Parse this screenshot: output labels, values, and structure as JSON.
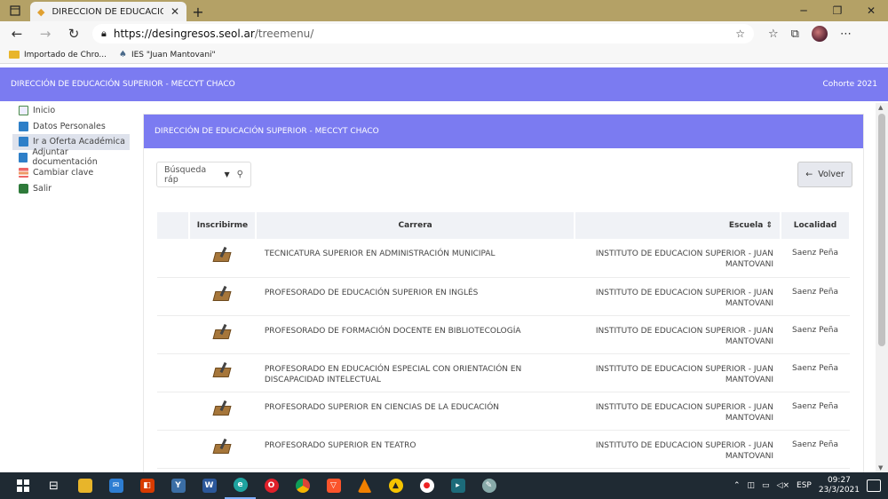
{
  "browser": {
    "tab_title": "DIRECCIÓN DE EDUCACIÓN SUP",
    "url_host": "https://desingresos.seol.ar",
    "url_path": "/treemenu/",
    "bookmarks": [
      {
        "label": "Importado de Chro..."
      },
      {
        "label": "IES \"Juan Mantovani\""
      }
    ]
  },
  "header": {
    "title": "DIRECCIÓN DE EDUCACIÓN SUPERIOR - MECCYT CHACO",
    "cohorte": "Cohorte 2021"
  },
  "sidebar": {
    "items": [
      {
        "label": "Inicio",
        "icon": "home-icon"
      },
      {
        "label": "Datos Personales",
        "icon": "card-icon"
      },
      {
        "label": "Ir a Oferta Académica",
        "icon": "card-icon"
      },
      {
        "label": "Adjuntar documentación",
        "icon": "card-icon"
      },
      {
        "label": "Cambiar clave",
        "icon": "key-icon"
      },
      {
        "label": "Salir",
        "icon": "exit-icon"
      }
    ]
  },
  "content": {
    "title": "DIRECCIÓN DE EDUCACIÓN SUPERIOR - MECCYT CHACO",
    "search_placeholder": "Búsqueda ráp",
    "volver_label": "Volver"
  },
  "table": {
    "headers": [
      "",
      "Inscribirme",
      "Carrera",
      "Escuela ⇕",
      "Localidad"
    ],
    "rows": [
      {
        "carrera": "TECNICATURA SUPERIOR EN ADMINISTRACIÓN MUNICIPAL",
        "escuela": "INSTITUTO DE EDUCACION SUPERIOR - JUAN MANTOVANI",
        "localidad": "Saenz Peña"
      },
      {
        "carrera": "PROFESORADO DE EDUCACIÓN SUPERIOR EN INGLÉS",
        "escuela": "INSTITUTO DE EDUCACION SUPERIOR - JUAN MANTOVANI",
        "localidad": "Saenz Peña"
      },
      {
        "carrera": "PROFESORADO DE FORMACIÓN DOCENTE EN BIBLIOTECOLOGÍA",
        "escuela": "INSTITUTO DE EDUCACION SUPERIOR - JUAN MANTOVANI",
        "localidad": "Saenz Peña"
      },
      {
        "carrera": "PROFESORADO EN EDUCACIÓN ESPECIAL CON ORIENTACIÓN EN DISCAPACIDAD INTELECTUAL",
        "escuela": "INSTITUTO DE EDUCACION SUPERIOR - JUAN MANTOVANI",
        "localidad": "Saenz Peña"
      },
      {
        "carrera": "PROFESORADO SUPERIOR EN CIENCIAS DE LA EDUCACIÓN",
        "escuela": "INSTITUTO DE EDUCACION SUPERIOR - JUAN MANTOVANI",
        "localidad": "Saenz Peña"
      },
      {
        "carrera": "PROFESORADO SUPERIOR EN TEATRO",
        "escuela": "INSTITUTO DE EDUCACION SUPERIOR - JUAN MANTOVANI",
        "localidad": "Saenz Peña"
      }
    ]
  },
  "taskbar": {
    "lang": "ESP",
    "time": "09:27",
    "date": "23/3/2021"
  }
}
